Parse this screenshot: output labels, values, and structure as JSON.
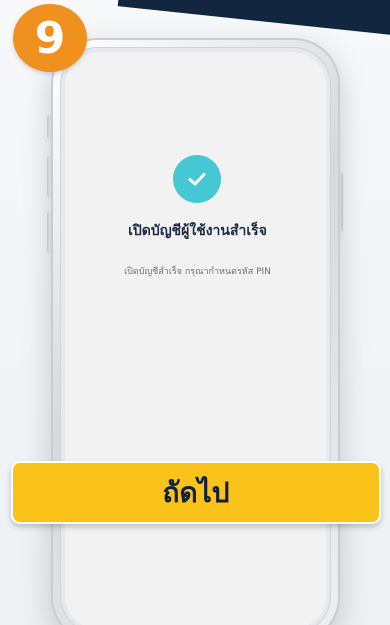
{
  "step": {
    "number": "9"
  },
  "screen": {
    "title": "เปิดบัญชีผู้ใช้งานสำเร็จ",
    "subtitle": "เปิดบัญชีสำเร็จ กรุณากำหนดรหัส PIN",
    "icon": "check-icon"
  },
  "actions": {
    "next_label": "ถัดไป"
  },
  "colors": {
    "badge": "#f0901e",
    "check": "#45c8d4",
    "button": "#fbc21a",
    "title_text": "#1f2b44"
  }
}
